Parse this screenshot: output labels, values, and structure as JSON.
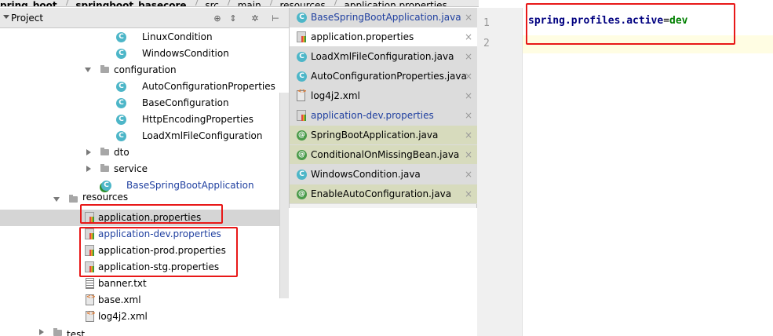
{
  "breadcrumb": [
    "pring_boot",
    "springboot_basecore",
    "src",
    "main",
    "resources",
    "application.properties"
  ],
  "project_panel": {
    "title": "Project"
  },
  "tree": [
    {
      "label": "LinuxCondition",
      "icon": "class-icon"
    },
    {
      "label": "WindowsCondition",
      "icon": "class-icon"
    },
    {
      "label": "configuration",
      "icon": "folder-icon"
    },
    {
      "label": "AutoConfigurationProperties",
      "icon": "class-icon"
    },
    {
      "label": "BaseConfiguration",
      "icon": "class-icon"
    },
    {
      "label": "HttpEncodingProperties",
      "icon": "class-icon"
    },
    {
      "label": "LoadXmlFileConfiguration",
      "icon": "class-icon"
    },
    {
      "label": "dto",
      "icon": "folder-icon"
    },
    {
      "label": "service",
      "icon": "folder-icon"
    },
    {
      "label": "BaseSpringBootApplication",
      "icon": "spring-app-icon"
    },
    {
      "label": "resources",
      "icon": "folder-icon"
    },
    {
      "label": "application.properties",
      "icon": "properties-file-icon"
    },
    {
      "label": "application-dev.properties",
      "icon": "properties-file-icon"
    },
    {
      "label": "application-prod.properties",
      "icon": "properties-file-icon"
    },
    {
      "label": "application-stg.properties",
      "icon": "properties-file-icon"
    },
    {
      "label": "banner.txt",
      "icon": "text-file-icon"
    },
    {
      "label": "base.xml",
      "icon": "xml-file-icon"
    },
    {
      "label": "log4j2.xml",
      "icon": "xml-file-icon"
    },
    {
      "label": "test",
      "icon": "folder-icon"
    }
  ],
  "tabs": [
    {
      "label": "BaseSpringBootApplication.java",
      "icon": "class-icon"
    },
    {
      "label": "application.properties",
      "icon": "properties-file-icon"
    },
    {
      "label": "LoadXmlFileConfiguration.java",
      "icon": "class-icon"
    },
    {
      "label": "AutoConfigurationProperties.java",
      "icon": "class-icon"
    },
    {
      "label": "log4j2.xml",
      "icon": "xml-file-icon"
    },
    {
      "label": "application-dev.properties",
      "icon": "properties-file-icon"
    },
    {
      "label": "SpringBootApplication.java",
      "icon": "annotation-icon"
    },
    {
      "label": "ConditionalOnMissingBean.java",
      "icon": "annotation-icon"
    },
    {
      "label": "WindowsCondition.java",
      "icon": "class-icon"
    },
    {
      "label": "EnableAutoConfiguration.java",
      "icon": "annotation-icon"
    }
  ],
  "tab_close_glyph": "×",
  "editor": {
    "line_numbers": [
      "1",
      "2"
    ],
    "line1_key": "spring.profiles.active",
    "line1_eq": "=",
    "line1_value": "dev"
  },
  "colors": {
    "highlight": "#e81818",
    "key": "#000080",
    "value": "#008000"
  }
}
